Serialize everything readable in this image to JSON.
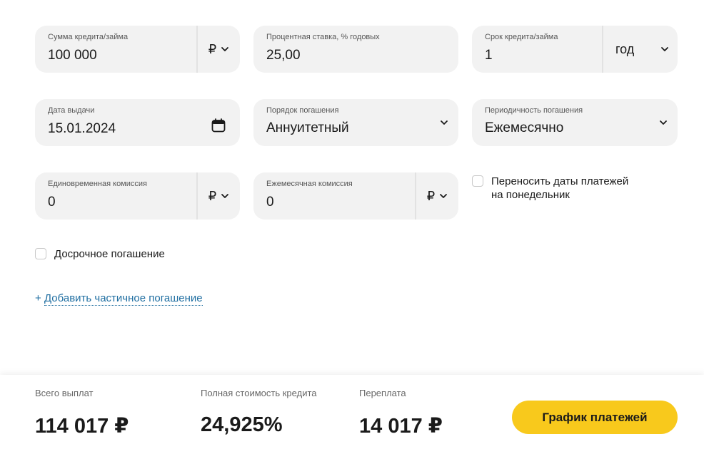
{
  "loan_amount": {
    "label": "Сумма кредита/займа",
    "value": "100 000",
    "unit": "₽"
  },
  "interest_rate": {
    "label": "Процентная ставка, % годовых",
    "value": "25,00"
  },
  "loan_term": {
    "label": "Срок кредита/займа",
    "value": "1",
    "unit": "год"
  },
  "issue_date": {
    "label": "Дата выдачи",
    "value": "15.01.2024"
  },
  "repayment_order": {
    "label": "Порядок погашения",
    "value": "Аннуитетный"
  },
  "repayment_frequency": {
    "label": "Периодичность погашения",
    "value": "Ежемесячно"
  },
  "one_time_fee": {
    "label": "Единовременная комиссия",
    "value": "0",
    "unit": "₽"
  },
  "monthly_fee": {
    "label": "Ежемесячная комиссия",
    "value": "0",
    "unit": "₽"
  },
  "move_dates_checkbox": {
    "line1": "Переносить даты платежей",
    "line2": "на понедельник",
    "checked": false
  },
  "early_repayment_checkbox": {
    "label": "Досрочное погашение",
    "checked": false
  },
  "add_partial_link": {
    "prefix": "+",
    "text": "Добавить частичное погашение"
  },
  "summary": {
    "total_payments": {
      "label": "Всего выплат",
      "value": "114 017 ₽"
    },
    "full_cost": {
      "label": "Полная стоимость кредита",
      "value": "24,925%"
    },
    "overpayment": {
      "label": "Переплата",
      "value": "14 017 ₽"
    }
  },
  "schedule_button": {
    "label": "График платежей"
  },
  "colors": {
    "field_bg": "#f2f2f2",
    "accent_button": "#f8c91c",
    "link": "#1f6ea1"
  },
  "icons": [
    "chevron-down-icon",
    "calendar-icon"
  ]
}
